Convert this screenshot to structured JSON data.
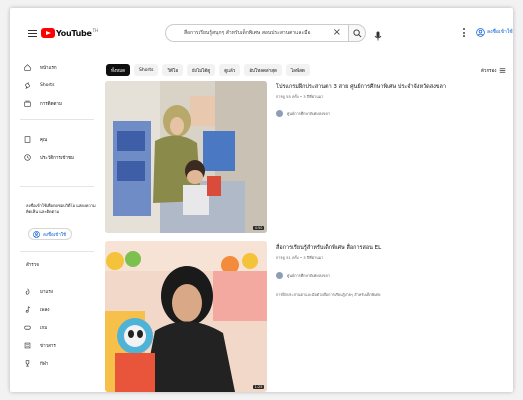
{
  "header": {
    "logo_text": "YouTube",
    "logo_region": "TH",
    "search_value": "สื่อการเรียนรู้สนุกๆ สำหรับเด็กพิเศษ สอนประสานตาและมือ",
    "signin_label": "ลงชื่อเข้าใช้"
  },
  "sidebar": {
    "items": [
      {
        "label": "หน้าแรก",
        "icon": "home-icon"
      },
      {
        "label": "Shorts",
        "icon": "shorts-icon"
      },
      {
        "label": "การติดตาม",
        "icon": "subscriptions-icon"
      },
      {
        "label": "คุณ",
        "icon": "you-icon"
      },
      {
        "label": "ประวัติการเข้าชม",
        "icon": "history-icon"
      }
    ],
    "note": "ลงชื่อเข้าใช้เพื่อกดชอบวิดีโอ แสดงความคิดเห็น และติดตาม",
    "signin_label": "ลงชื่อเข้าใช้",
    "explore_heading": "สำรวจ",
    "explore_items": [
      {
        "label": "มาแรง",
        "icon": "trending-icon"
      },
      {
        "label": "เพลง",
        "icon": "music-icon"
      },
      {
        "label": "เกม",
        "icon": "gaming-icon"
      },
      {
        "label": "ข่าวสาร",
        "icon": "news-icon"
      },
      {
        "label": "กีฬา",
        "icon": "sports-icon"
      }
    ]
  },
  "chips": [
    "ทั้งหมด",
    "Shorts",
    "วิดีโอ",
    "ยังไม่ได้ดู",
    "ดูแล้ว",
    "อัปโหลดล่าสุด",
    "ไลฟ์สด"
  ],
  "filters_label": "ตัวกรอง",
  "results": [
    {
      "title": "โปรแกรมฝึกประสานตา 3 สาย ศูนย์การศึกษาพิเศษ ประจำจังหวัดสงขลา",
      "meta": "การดู 55 ครั้ง • 3 ปีที่ผ่านมา",
      "channel": "ศูนย์การศึกษาพิเศษสงขลา",
      "duration": "4:50",
      "description": ""
    },
    {
      "title": "สื่อการเรียนรู้สำหรับเด็กพิเศษ สื่อการสอน EL",
      "meta": "การดู 51 ครั้ง • 3 ปีที่ผ่านมา",
      "channel": "ศูนย์การศึกษาพิเศษสงขลา",
      "duration": "1:25",
      "description": "การฝึกประสานตาและมือด้วยสื่อการเรียนรู้ง่ายๆ สำหรับเด็กพิเศษ"
    }
  ],
  "colors": {
    "brand_red": "#ff0000",
    "link_blue": "#065fd4"
  }
}
